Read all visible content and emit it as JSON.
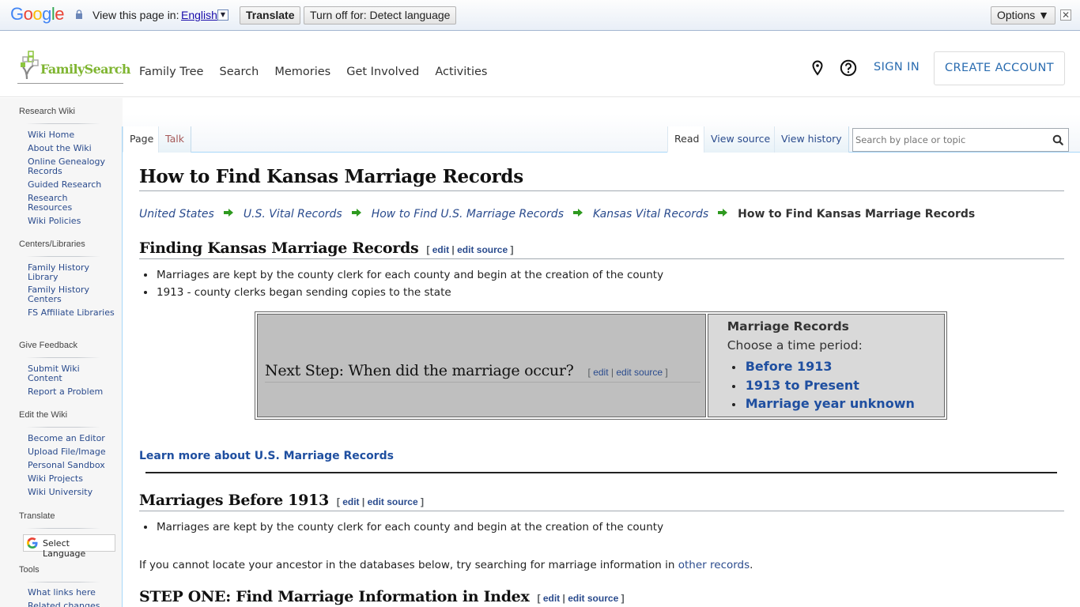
{
  "translate_bar": {
    "brand": "Google",
    "view_label": "View this page in:",
    "language": "English",
    "translate_button": "Translate",
    "turn_off_button": "Turn off for: Detect language",
    "options_button": "Options ▼",
    "close": "✕"
  },
  "header": {
    "logo_text": "FamilySearch",
    "nav": [
      "Family Tree",
      "Search",
      "Memories",
      "Get Involved",
      "Activities"
    ],
    "sign_in": "SIGN IN",
    "create_account": "CREATE ACCOUNT",
    "brand_color": "#7fb531",
    "link_color": "#2a6cb0"
  },
  "sidebar": {
    "sections": [
      {
        "heading": "Research Wiki",
        "items": [
          "Wiki Home",
          "About the Wiki",
          "Online Genealogy Records",
          "Guided Research",
          "Research Resources",
          "Wiki Policies"
        ]
      },
      {
        "heading": "Centers/Libraries",
        "items": [
          "Family History Library",
          "Family History Centers",
          "FS Affiliate Libraries"
        ]
      },
      {
        "heading": "Give Feedback",
        "items": [
          "Submit Wiki Content",
          "Report a Problem"
        ]
      },
      {
        "heading": "Edit the Wiki",
        "items": [
          "Become an Editor",
          "Upload File/Image",
          "Personal Sandbox",
          "Wiki Projects",
          "Wiki University"
        ]
      },
      {
        "heading": "Translate",
        "select_language": "Select Language"
      },
      {
        "heading": "Tools",
        "items": [
          "What links here",
          "Related changes"
        ]
      }
    ]
  },
  "tabs": {
    "left": [
      {
        "label": "Page",
        "selected": true
      },
      {
        "label": "Talk",
        "selected": false
      }
    ],
    "right": [
      {
        "label": "Read",
        "selected": true
      },
      {
        "label": "View source",
        "selected": false
      },
      {
        "label": "View history",
        "selected": false
      }
    ],
    "search_placeholder": "Search by place or topic"
  },
  "article": {
    "title": "How to Find Kansas Marriage Records",
    "breadcrumb": [
      "United States",
      "U.S. Vital Records",
      "How to Find U.S. Marriage Records",
      "Kansas Vital Records"
    ],
    "breadcrumb_current": "How to Find Kansas Marriage Records",
    "edit": "edit",
    "edit_source": "edit source",
    "sections": [
      {
        "heading": "Finding Kansas Marriage Records",
        "bullets": [
          "Marriages are kept by the county clerk for each county and begin at the creation of the county",
          "1913 - county clerks began sending copies to the state"
        ]
      },
      {
        "heading": "Marriages Before 1913",
        "bullets": [
          "Marriages are kept by the county clerk for each county and begin at the creation of the county"
        ]
      },
      {
        "heading": "STEP ONE: Find Marriage Information in Index"
      }
    ],
    "next_step": {
      "heading": "Next Step: When did the marriage occur?",
      "box_title": "Marriage Records",
      "box_sub": "Choose a time period:",
      "links": [
        "Before 1913",
        "1913 to Present",
        "Marriage year unknown"
      ]
    },
    "learn_more": "Learn more about U.S. Marriage Records",
    "paragraph_text": "If you cannot locate your ancestor in the databases below, try searching for marriage information in ",
    "paragraph_link": "other records",
    "paragraph_end": "."
  }
}
